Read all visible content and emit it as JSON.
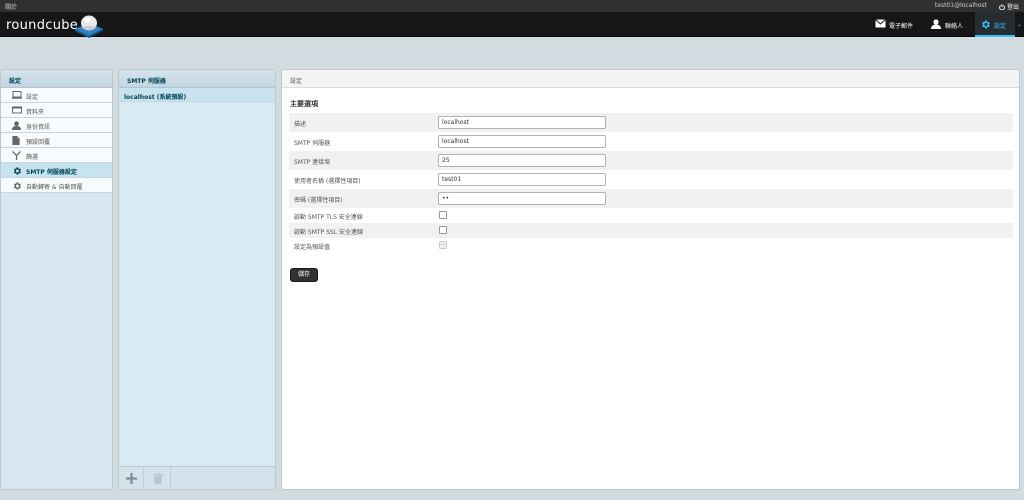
{
  "topline": {
    "about": "關於",
    "username": "test01@localhost",
    "logout": "登出"
  },
  "header": {
    "logo_text": "roundcube"
  },
  "taskbar": {
    "mail": "電子郵件",
    "contacts": "聯絡人",
    "settings": "設定",
    "more": "⌄"
  },
  "settings_nav": {
    "header": "設定",
    "items": [
      {
        "label": "設定",
        "icon": "monitor-icon"
      },
      {
        "label": "資料夾",
        "icon": "folder-icon"
      },
      {
        "label": "身份資訊",
        "icon": "user-icon"
      },
      {
        "label": "預設回覆",
        "icon": "document-icon"
      },
      {
        "label": "篩選",
        "icon": "filter-icon"
      },
      {
        "label": "SMTP 伺服器設定",
        "icon": "gear-icon",
        "selected": true
      },
      {
        "label": "自動轉寄 & 自動回覆",
        "icon": "gear-icon"
      }
    ]
  },
  "identities": {
    "header": "SMTP 伺服器",
    "rows": [
      "localhost (系統預設)"
    ]
  },
  "prefs": {
    "header": "設定",
    "section_title": "主要選項",
    "fields": [
      {
        "label": "描述",
        "value": "localhost"
      },
      {
        "label": "SMTP 伺服器",
        "value": "localhost"
      },
      {
        "label": "SMTP 連接埠",
        "value": "25"
      },
      {
        "label": "使用者名稱 (選擇性項目)",
        "value": "test01"
      },
      {
        "label": "密碼 (選擇性項目)",
        "value": "••"
      }
    ],
    "checkboxes": [
      {
        "label": "啟動 SMTP TLS 安全連線",
        "checked": false
      },
      {
        "label": "啟動 SMTP SSL 安全連線",
        "checked": false
      },
      {
        "label": "設定為預設值",
        "checked": false,
        "disabled": true
      }
    ],
    "save_label": "儲存"
  },
  "colors": {
    "accent": "#37beff",
    "header_bg": "#151617",
    "selected_bg": "#c7e3ef"
  }
}
